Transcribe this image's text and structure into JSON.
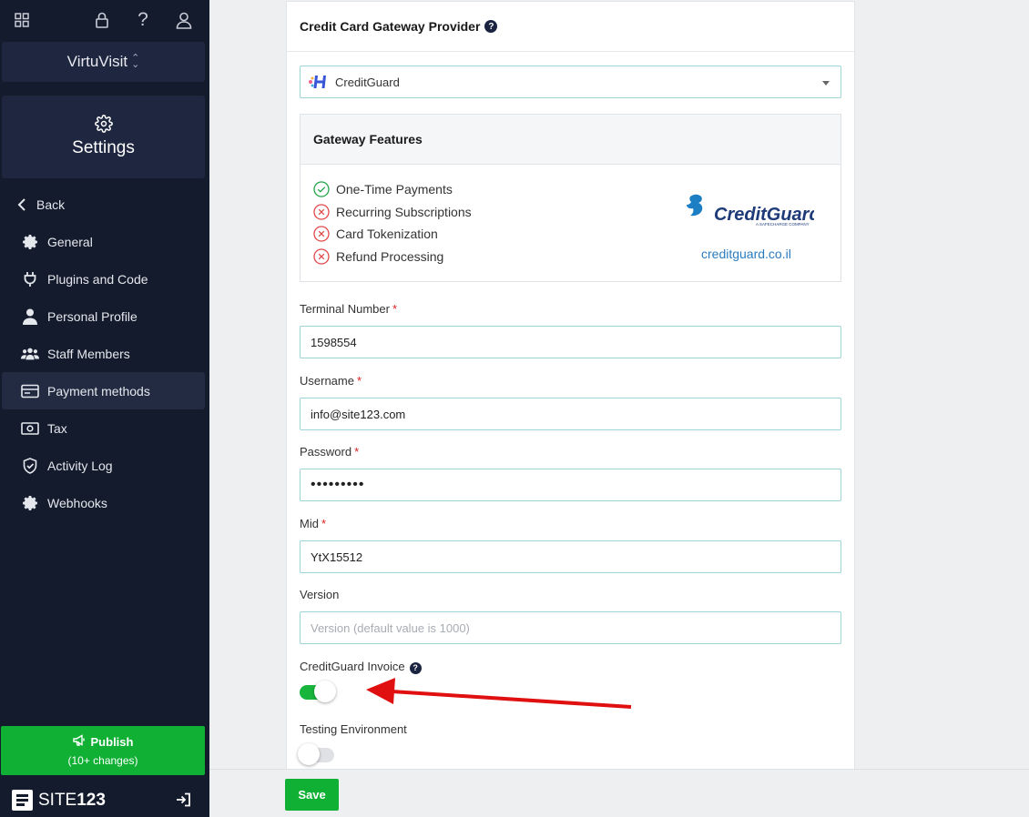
{
  "sidebar": {
    "site_name": "VirtuVisit",
    "section_title": "Settings",
    "back_label": "Back",
    "items": [
      {
        "label": "General",
        "icon": "gear-icon"
      },
      {
        "label": "Plugins and Code",
        "icon": "plug-icon"
      },
      {
        "label": "Personal Profile",
        "icon": "user-icon"
      },
      {
        "label": "Staff Members",
        "icon": "users-icon"
      },
      {
        "label": "Payment methods",
        "icon": "credit-card-icon",
        "active": true
      },
      {
        "label": "Tax",
        "icon": "money-icon"
      },
      {
        "label": "Activity Log",
        "icon": "shield-check-icon"
      },
      {
        "label": "Webhooks",
        "icon": "gear-icon"
      }
    ],
    "publish": {
      "label": "Publish",
      "sub": "(10+ changes)"
    },
    "brand": {
      "text_a": "SITE",
      "text_b": "123"
    }
  },
  "main": {
    "section_title": "Credit Card Gateway Provider",
    "provider_select": "CreditGuard",
    "gateway": {
      "title": "Gateway Features",
      "features": [
        {
          "label": "One-Time Payments",
          "supported": true
        },
        {
          "label": "Recurring Subscriptions",
          "supported": false
        },
        {
          "label": "Card Tokenization",
          "supported": false
        },
        {
          "label": "Refund Processing",
          "supported": false
        }
      ],
      "logo_text": "CreditGuard",
      "logo_sub": "A SAFECHARGE COMPANY",
      "link": "creditguard.co.il"
    },
    "fields": {
      "terminal": {
        "label": "Terminal Number",
        "value": "1598554"
      },
      "username": {
        "label": "Username",
        "value": "info@site123.com"
      },
      "password": {
        "label": "Password",
        "value": "•••••••••"
      },
      "mid": {
        "label": "Mid",
        "value": "YtX15512"
      },
      "version": {
        "label": "Version",
        "placeholder": "Version (default value is 1000)"
      }
    },
    "invoice_toggle": {
      "label": "CreditGuard Invoice",
      "on": true
    },
    "testing_toggle": {
      "label": "Testing Environment",
      "on": false
    },
    "required_mark": "*",
    "help_mark": "?"
  },
  "footer": {
    "save_label": "Save"
  },
  "colors": {
    "sidebar_bg": "#141b2d",
    "accent_green": "#0fb034",
    "input_border": "#9fd4d8",
    "annotation_arrow": "#e01010"
  }
}
